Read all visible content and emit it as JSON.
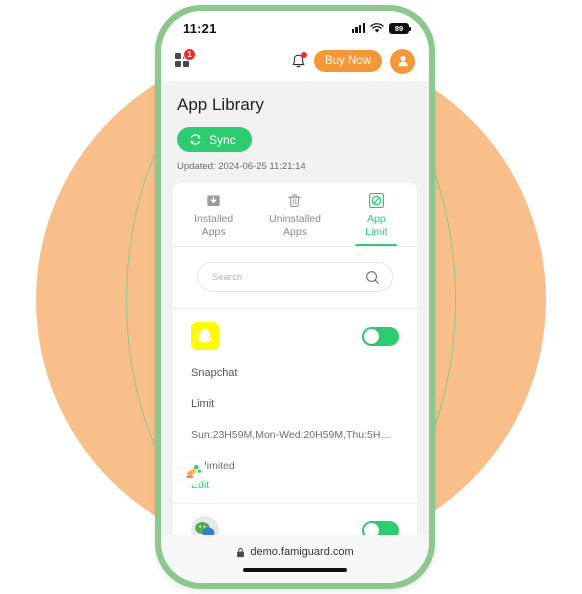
{
  "status_bar": {
    "time": "11:21",
    "battery_level": "89",
    "signal_icon": "cellular-signal-icon",
    "wifi_icon": "wifi-icon",
    "battery_icon": "battery-icon"
  },
  "app_bar": {
    "menu_icon": "app-grid-icon",
    "menu_badge": "1",
    "bell_icon": "notification-bell-icon",
    "buy_now_label": "Buy Now",
    "avatar_icon": "user-avatar-icon"
  },
  "page": {
    "title": "App Library",
    "sync_label": "Sync",
    "sync_icon": "refresh-icon",
    "updated_text": "Updated: 2024-06-25 11:21:14"
  },
  "tabs": [
    {
      "label": "Installed\nApps",
      "line1": "Installed",
      "line2": "Apps",
      "icon": "installed-box-icon",
      "active": false
    },
    {
      "label": "Uninstalled\nApps",
      "line1": "Uninstalled",
      "line2": "Apps",
      "icon": "trash-icon",
      "active": false
    },
    {
      "label": "App\nLimit",
      "line1": "App",
      "line2": "Limit",
      "icon": "block-circle-icon",
      "active": true
    }
  ],
  "search": {
    "placeholder": "Search",
    "value": "",
    "icon": "search-icon"
  },
  "apps": [
    {
      "name": "Snapchat",
      "icon": "snapchat-ghost-icon",
      "icon_bg": "#FFFC00",
      "toggle_on": true,
      "limit_label": "Limit",
      "limit_value": "Sun:23H59M,Mon-Wed:20H59M,Thu:5H…",
      "usage": "Unlimited",
      "edit_label": "Edit",
      "cursor_icon": "famiguard-cursor-icon"
    },
    {
      "name": "",
      "icon": "wechat-icon",
      "icon_bg": "#E8E8E8",
      "toggle_on": true
    }
  ],
  "browser": {
    "lock_icon": "lock-icon",
    "url": "demo.famiguard.com",
    "home_indicator": "home-indicator"
  },
  "colors": {
    "accent_green": "#2ECC71",
    "accent_orange": "#F79838",
    "badge_red": "#EE2C2C",
    "frame_green": "#8CC78E",
    "blob_orange": "#F9BF8B",
    "snapchat_yellow": "#FFFC00"
  }
}
